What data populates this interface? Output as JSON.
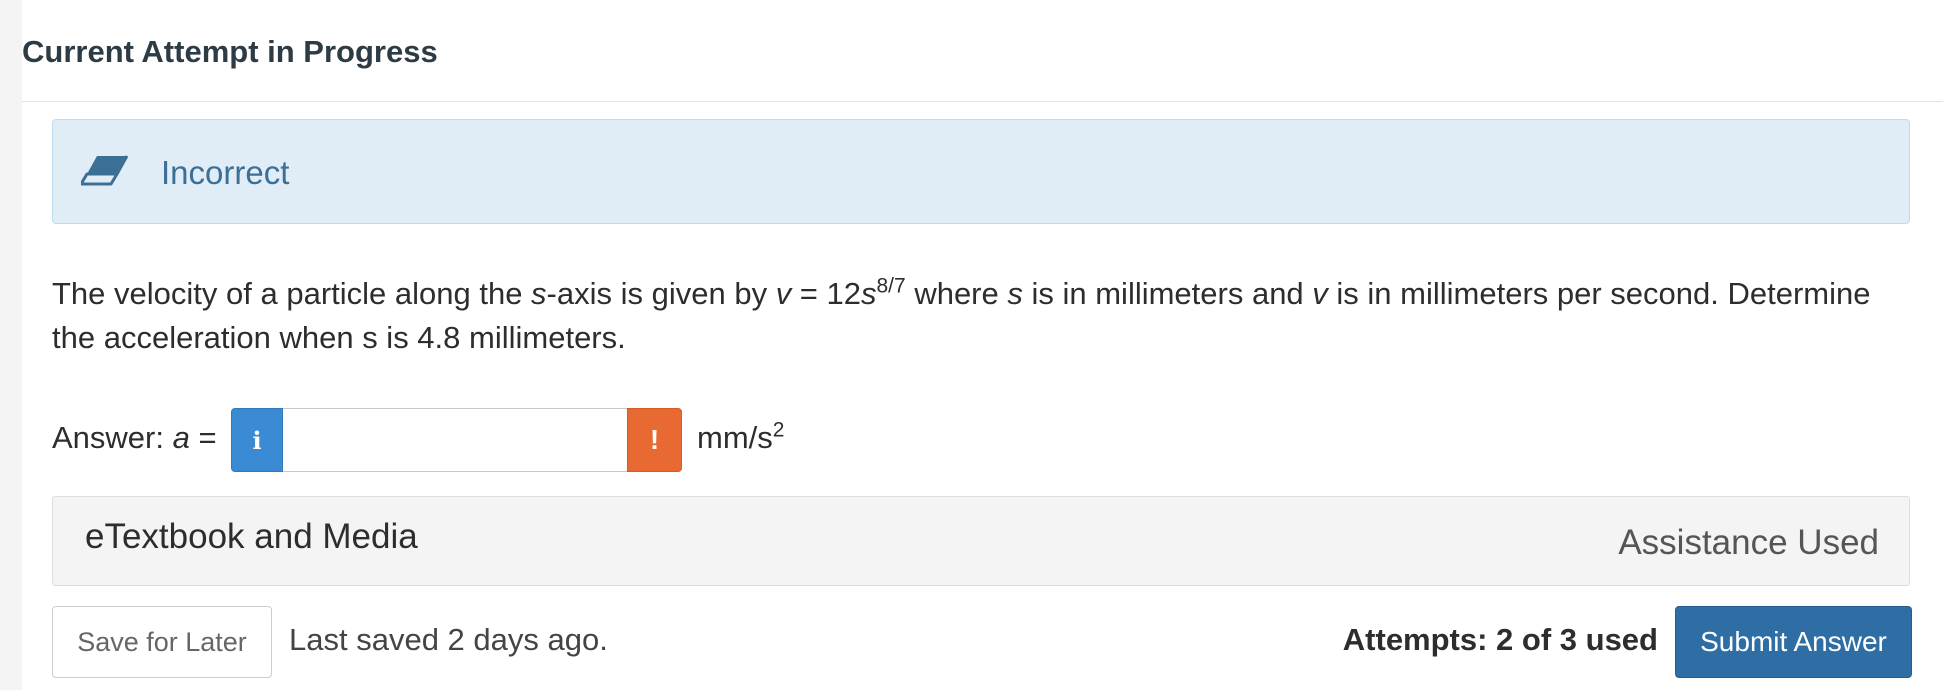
{
  "header": {
    "title": "Current Attempt in Progress"
  },
  "feedback": {
    "status": "Incorrect",
    "icon": "eraser-icon"
  },
  "question": {
    "part1": "The velocity of a particle along the ",
    "var_s1": "s",
    "part2": "-axis is given by ",
    "var_v1": "v",
    "part3": " = 12",
    "var_s2": "s",
    "exponent": "8/7",
    "part4": " where ",
    "var_s3": "s",
    "part5": " is in millimeters and ",
    "var_v2": "v",
    "part6": " is in millimeters per second. Determine the acceleration when s is 4.8 millimeters."
  },
  "answer": {
    "label_prefix": "Answer: ",
    "label_var": "a",
    "label_suffix": " =",
    "value": "",
    "info_symbol": "i",
    "warn_symbol": "!",
    "unit_base": "mm/s",
    "unit_exp": "2"
  },
  "media": {
    "link_label": "eTextbook and Media",
    "assistance": "Assistance Used"
  },
  "footer": {
    "save_label": "Save for Later",
    "last_saved": "Last saved 2 days ago.",
    "attempts": "Attempts: 2 of 3 used",
    "submit_label": "Submit Answer"
  },
  "colors": {
    "alert_bg": "#e0edf7",
    "alert_text": "#3c6f95",
    "info_button": "#3a8ad4",
    "warn_button": "#e86a32",
    "submit_button": "#2f6ea4"
  }
}
